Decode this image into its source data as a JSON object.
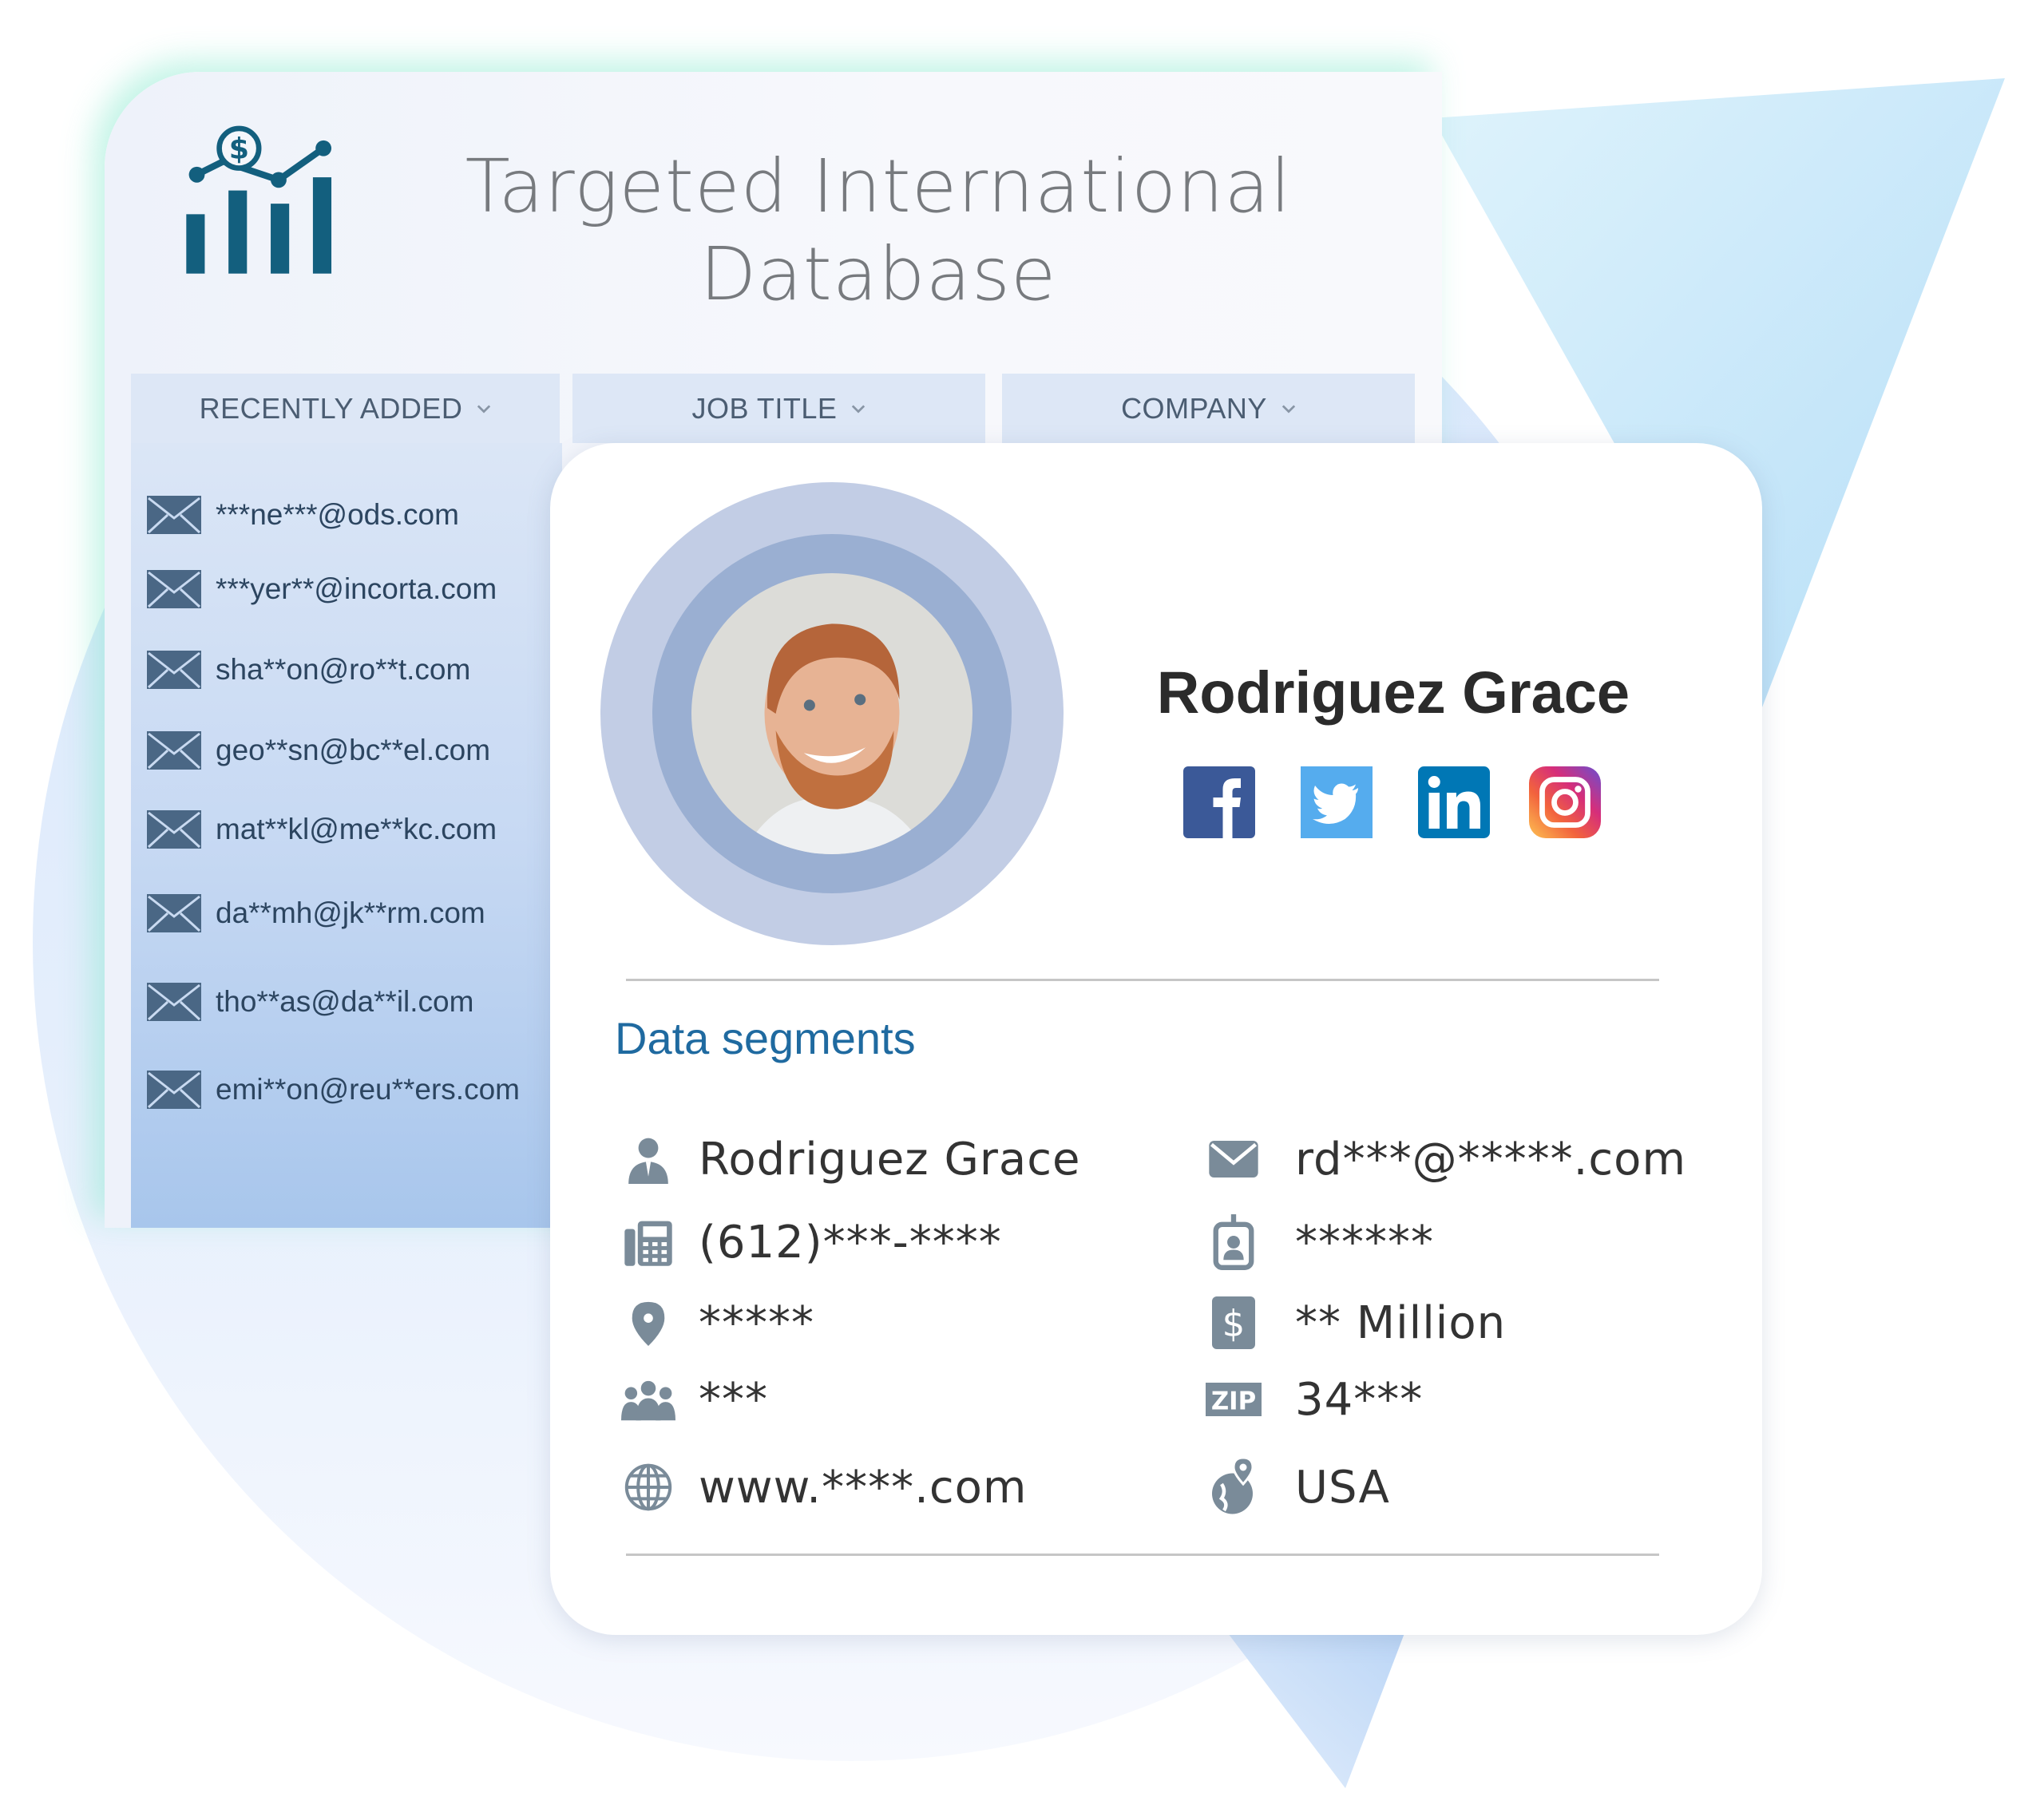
{
  "header": {
    "title_line1": "Targeted International",
    "title_line2": "Database"
  },
  "tabs": [
    {
      "label": "RECENTLY ADDED"
    },
    {
      "label": "JOB TITLE"
    },
    {
      "label": "COMPANY"
    }
  ],
  "recent_emails": [
    "***ne***@ods.com",
    "***yer**@incorta.com",
    "sha**on@ro**t.com",
    "geo**sn@bc**el.com",
    "mat**kl@me**kc.com",
    "da**mh@jk**rm.com",
    "tho**as@da**il.com",
    "emi**on@reu**ers.com"
  ],
  "profile": {
    "name": "Rodriguez Grace",
    "socials": [
      "facebook",
      "twitter",
      "linkedin",
      "instagram"
    ]
  },
  "segments": {
    "title": "Data segments",
    "left": [
      {
        "icon": "person-icon",
        "value": "Rodriguez Grace"
      },
      {
        "icon": "phone-icon",
        "value": "(612)***-****"
      },
      {
        "icon": "location-pin-icon",
        "value": "*****"
      },
      {
        "icon": "team-icon",
        "value": "***"
      },
      {
        "icon": "globe-icon",
        "value": "www.****.com"
      }
    ],
    "right": [
      {
        "icon": "envelope-icon",
        "value": "rd***@*****.com"
      },
      {
        "icon": "id-badge-icon",
        "value": "******"
      },
      {
        "icon": "dollar-icon",
        "value": "** Million"
      },
      {
        "icon": "zip-icon",
        "value": "34***"
      },
      {
        "icon": "globe-pin-icon",
        "value": "USA"
      }
    ]
  },
  "colors": {
    "accent": "#1f6aa0",
    "icon_gray": "#7a8b99",
    "logo": "#135f7e",
    "facebook": "#3b5998",
    "twitter": "#55acee",
    "linkedin": "#0077b5"
  }
}
